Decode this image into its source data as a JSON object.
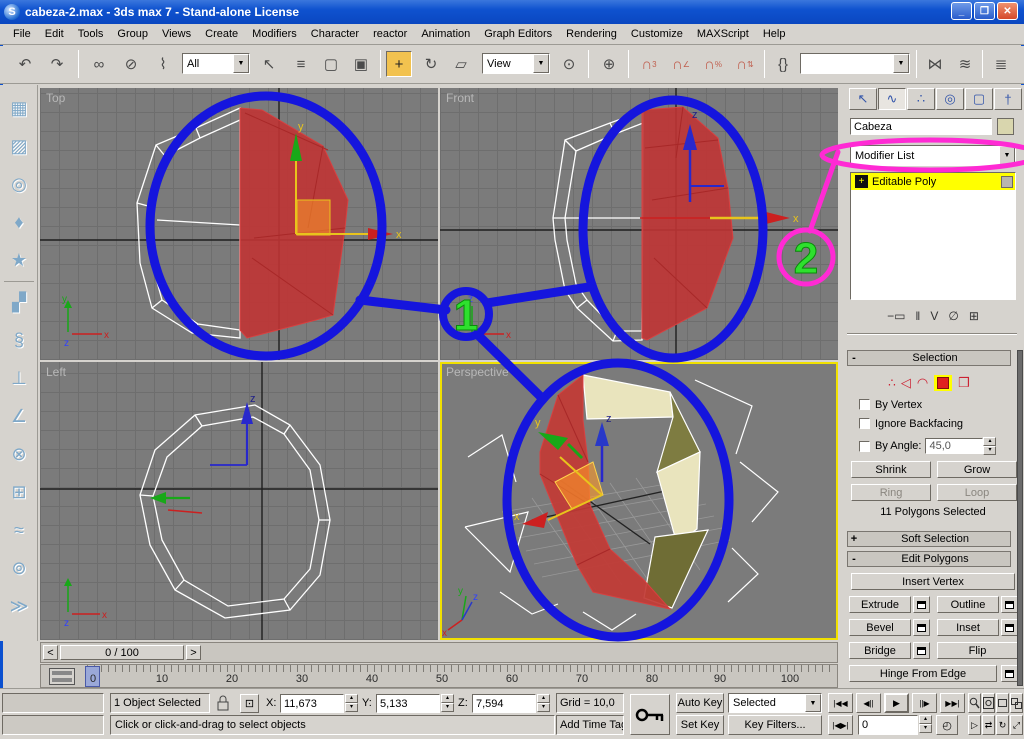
{
  "window": {
    "title": "cabeza-2.max - 3ds max 7  - Stand-alone License",
    "logo_letter": "S",
    "minimize": "_",
    "maximize": "❐",
    "close": "✕"
  },
  "menu": {
    "items": [
      "File",
      "Edit",
      "Tools",
      "Group",
      "Views",
      "Create",
      "Modifiers",
      "Character",
      "reactor",
      "Animation",
      "Graph Editors",
      "Rendering",
      "Customize",
      "MAXScript",
      "Help"
    ]
  },
  "toolbar": {
    "selection_filter_value": "All",
    "ref_coord_value": "View",
    "named_selection_value": "",
    "icons": {
      "undo": "↶",
      "redo": "↷",
      "link": "∞",
      "unlink": "⊘",
      "bind": "⌇",
      "select": "↖",
      "select_by_name": "≡",
      "rect_region": "▢",
      "window_crossing": "▣",
      "move": "+",
      "rotate": "↻",
      "scale": "▱",
      "pivot": "⊙",
      "manipulate": "⊕",
      "snap": "∩",
      "snap_sup": "3",
      "angle_snap_sup": "∠",
      "percent_snap_sup": "%",
      "spinner_snap_sup": "⇅",
      "named_sel": "{}",
      "mirror": "⋈",
      "align": "≋",
      "layers": "≣"
    }
  },
  "left_toolbar": {
    "items": [
      {
        "name": "rigid-body-collection",
        "glyph": "▦"
      },
      {
        "name": "cloth-collection",
        "glyph": "▨"
      },
      {
        "name": "soft-body-collection",
        "glyph": "◎"
      },
      {
        "name": "rope-collection",
        "glyph": "♦"
      },
      {
        "name": "deforming-mesh-collection",
        "glyph": "★"
      },
      {
        "name": "plane",
        "glyph": "▞"
      },
      {
        "name": "spring",
        "glyph": "§"
      },
      {
        "name": "linear-dashpot",
        "glyph": "⊥"
      },
      {
        "name": "angular-dashpot",
        "glyph": "∠"
      },
      {
        "name": "motor",
        "glyph": "⊗"
      },
      {
        "name": "fracture",
        "glyph": "⊞"
      },
      {
        "name": "water",
        "glyph": "≈"
      },
      {
        "name": "toy-car",
        "glyph": "⊚"
      },
      {
        "name": "wind",
        "glyph": "≫"
      }
    ]
  },
  "viewports": {
    "top_label": "Top",
    "front_label": "Front",
    "left_label": "Left",
    "perspective_label": "Perspective",
    "axis": {
      "x": "x",
      "y": "y",
      "z": "z"
    }
  },
  "annotations": {
    "step1": "1",
    "step2": "2",
    "blue": "#1515dd",
    "magenta": "#ff2ad4",
    "green": "#2ee02e"
  },
  "command_panel": {
    "tabs": [
      "create",
      "modify",
      "hierarchy",
      "motion",
      "display",
      "utilities"
    ],
    "tab_icons": {
      "create": "↖",
      "modify": "∿",
      "hierarchy": "∴",
      "motion": "◎",
      "display": "▢",
      "utilities": "†"
    },
    "object_name": "Cabeza",
    "modifier_list_label": "Modifier List",
    "stack_item": "Editable Poly",
    "stack_plus": "+",
    "stack_icons": {
      "pin": "−▭",
      "show_end_result": "‖",
      "make_unique": "V",
      "remove_modifier": "∅",
      "configure": "⊞"
    },
    "selection": {
      "header": "Selection",
      "minus": "-",
      "by_vertex": "By Vertex",
      "ignore_backfacing": "Ignore Backfacing",
      "by_angle": "By Angle:",
      "by_angle_value": "45,0",
      "shrink": "Shrink",
      "grow": "Grow",
      "ring": "Ring",
      "loop": "Loop",
      "status": "11 Polygons Selected"
    },
    "soft_selection": {
      "header": "Soft Selection",
      "plus": "+"
    },
    "edit_polygons": {
      "header": "Edit Polygons",
      "minus": "-",
      "insert_vertex": "Insert Vertex",
      "extrude": "Extrude",
      "outline": "Outline",
      "bevel": "Bevel",
      "inset": "Inset",
      "bridge": "Bridge",
      "flip": "Flip",
      "hinge_from_edge": "Hinge From Edge"
    }
  },
  "timeline": {
    "track_value": "0 / 100",
    "prev": "<",
    "next": ">",
    "labels": [
      "0",
      "10",
      "20",
      "30",
      "40",
      "50",
      "60",
      "70",
      "80",
      "90",
      "100"
    ]
  },
  "status_bar": {
    "selection_status": "1 Object Selected",
    "x_label": "X:",
    "x_value": "11,673",
    "y_label": "Y:",
    "y_value": "5,133",
    "z_label": "Z:",
    "z_value": "7,594",
    "grid_value": "Grid = 10,0",
    "prompt": "Click or click-and-drag to select objects",
    "add_time_tag": "Add Time Tag",
    "auto_key": "Auto Key",
    "set_key": "Set Key",
    "key_filter_dropdown": "Selected",
    "key_filters": "Key Filters...",
    "frame_value": "0",
    "playback": {
      "start": "|◀◀",
      "prev": "◀||",
      "play": "▶",
      "next": "||▶",
      "end": "▶▶|",
      "key_mode": "|◀▶|",
      "time_config": "◴"
    },
    "nav": {
      "region_zoom": "▷",
      "pan": "⇄",
      "arc_rotate": "↻",
      "min_max": "⤢"
    }
  }
}
